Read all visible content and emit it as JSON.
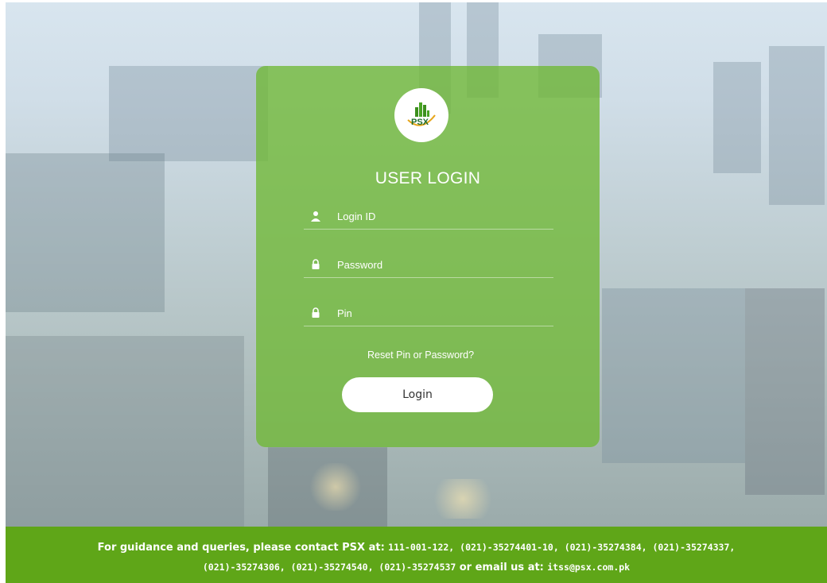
{
  "login": {
    "title": "USER LOGIN",
    "logo_text": "PSX",
    "login_id_placeholder": "Login ID",
    "password_placeholder": "Password",
    "pin_placeholder": "Pin",
    "reset_link": "Reset Pin or Password?",
    "login_button": "Login"
  },
  "footer": {
    "lead1": "For guidance and queries, please contact PSX at:",
    "numbers1": "111-001-122, (021)-35274401-10, (021)-35274384, (021)-35274337,",
    "numbers2": "(021)-35274306, (021)-35274540, (021)-35274537",
    "lead2": "or email us at:",
    "email": "itss@psx.com.pk"
  },
  "colors": {
    "card": "#70b834",
    "footer": "#5fa618",
    "text": "#ffffff"
  },
  "icons": [
    "psx-logo-icon",
    "user-icon",
    "lock-icon",
    "pin-lock-icon"
  ]
}
